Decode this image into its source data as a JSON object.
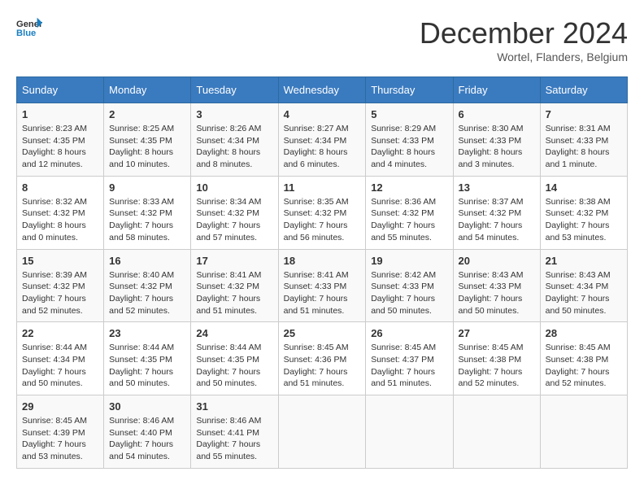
{
  "logo": {
    "line1": "General",
    "line2": "Blue"
  },
  "title": "December 2024",
  "location": "Wortel, Flanders, Belgium",
  "days_of_week": [
    "Sunday",
    "Monday",
    "Tuesday",
    "Wednesday",
    "Thursday",
    "Friday",
    "Saturday"
  ],
  "weeks": [
    [
      {
        "day": "1",
        "sunrise": "8:23 AM",
        "sunset": "4:35 PM",
        "daylight": "8 hours and 12 minutes."
      },
      {
        "day": "2",
        "sunrise": "8:25 AM",
        "sunset": "4:35 PM",
        "daylight": "8 hours and 10 minutes."
      },
      {
        "day": "3",
        "sunrise": "8:26 AM",
        "sunset": "4:34 PM",
        "daylight": "8 hours and 8 minutes."
      },
      {
        "day": "4",
        "sunrise": "8:27 AM",
        "sunset": "4:34 PM",
        "daylight": "8 hours and 6 minutes."
      },
      {
        "day": "5",
        "sunrise": "8:29 AM",
        "sunset": "4:33 PM",
        "daylight": "8 hours and 4 minutes."
      },
      {
        "day": "6",
        "sunrise": "8:30 AM",
        "sunset": "4:33 PM",
        "daylight": "8 hours and 3 minutes."
      },
      {
        "day": "7",
        "sunrise": "8:31 AM",
        "sunset": "4:33 PM",
        "daylight": "8 hours and 1 minute."
      }
    ],
    [
      {
        "day": "8",
        "sunrise": "8:32 AM",
        "sunset": "4:32 PM",
        "daylight": "8 hours and 0 minutes."
      },
      {
        "day": "9",
        "sunrise": "8:33 AM",
        "sunset": "4:32 PM",
        "daylight": "7 hours and 58 minutes."
      },
      {
        "day": "10",
        "sunrise": "8:34 AM",
        "sunset": "4:32 PM",
        "daylight": "7 hours and 57 minutes."
      },
      {
        "day": "11",
        "sunrise": "8:35 AM",
        "sunset": "4:32 PM",
        "daylight": "7 hours and 56 minutes."
      },
      {
        "day": "12",
        "sunrise": "8:36 AM",
        "sunset": "4:32 PM",
        "daylight": "7 hours and 55 minutes."
      },
      {
        "day": "13",
        "sunrise": "8:37 AM",
        "sunset": "4:32 PM",
        "daylight": "7 hours and 54 minutes."
      },
      {
        "day": "14",
        "sunrise": "8:38 AM",
        "sunset": "4:32 PM",
        "daylight": "7 hours and 53 minutes."
      }
    ],
    [
      {
        "day": "15",
        "sunrise": "8:39 AM",
        "sunset": "4:32 PM",
        "daylight": "7 hours and 52 minutes."
      },
      {
        "day": "16",
        "sunrise": "8:40 AM",
        "sunset": "4:32 PM",
        "daylight": "7 hours and 52 minutes."
      },
      {
        "day": "17",
        "sunrise": "8:41 AM",
        "sunset": "4:32 PM",
        "daylight": "7 hours and 51 minutes."
      },
      {
        "day": "18",
        "sunrise": "8:41 AM",
        "sunset": "4:33 PM",
        "daylight": "7 hours and 51 minutes."
      },
      {
        "day": "19",
        "sunrise": "8:42 AM",
        "sunset": "4:33 PM",
        "daylight": "7 hours and 50 minutes."
      },
      {
        "day": "20",
        "sunrise": "8:43 AM",
        "sunset": "4:33 PM",
        "daylight": "7 hours and 50 minutes."
      },
      {
        "day": "21",
        "sunrise": "8:43 AM",
        "sunset": "4:34 PM",
        "daylight": "7 hours and 50 minutes."
      }
    ],
    [
      {
        "day": "22",
        "sunrise": "8:44 AM",
        "sunset": "4:34 PM",
        "daylight": "7 hours and 50 minutes."
      },
      {
        "day": "23",
        "sunrise": "8:44 AM",
        "sunset": "4:35 PM",
        "daylight": "7 hours and 50 minutes."
      },
      {
        "day": "24",
        "sunrise": "8:44 AM",
        "sunset": "4:35 PM",
        "daylight": "7 hours and 50 minutes."
      },
      {
        "day": "25",
        "sunrise": "8:45 AM",
        "sunset": "4:36 PM",
        "daylight": "7 hours and 51 minutes."
      },
      {
        "day": "26",
        "sunrise": "8:45 AM",
        "sunset": "4:37 PM",
        "daylight": "7 hours and 51 minutes."
      },
      {
        "day": "27",
        "sunrise": "8:45 AM",
        "sunset": "4:38 PM",
        "daylight": "7 hours and 52 minutes."
      },
      {
        "day": "28",
        "sunrise": "8:45 AM",
        "sunset": "4:38 PM",
        "daylight": "7 hours and 52 minutes."
      }
    ],
    [
      {
        "day": "29",
        "sunrise": "8:45 AM",
        "sunset": "4:39 PM",
        "daylight": "7 hours and 53 minutes."
      },
      {
        "day": "30",
        "sunrise": "8:46 AM",
        "sunset": "4:40 PM",
        "daylight": "7 hours and 54 minutes."
      },
      {
        "day": "31",
        "sunrise": "8:46 AM",
        "sunset": "4:41 PM",
        "daylight": "7 hours and 55 minutes."
      },
      null,
      null,
      null,
      null
    ]
  ]
}
